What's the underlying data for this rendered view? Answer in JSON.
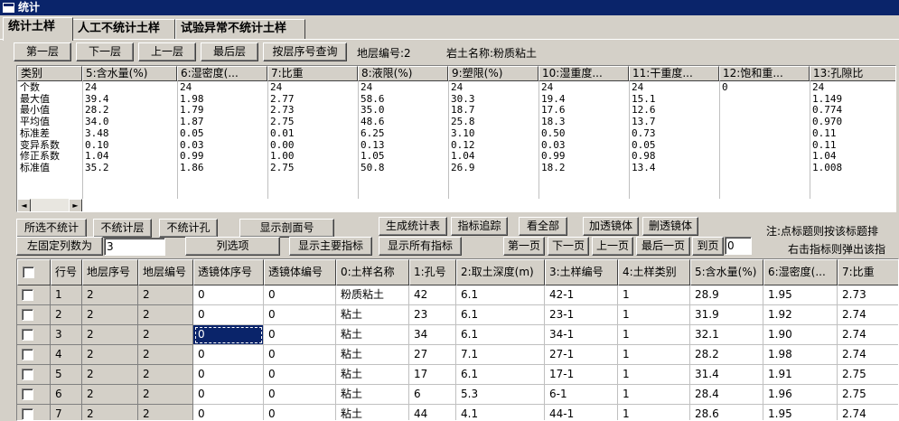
{
  "window": {
    "title": "统计"
  },
  "tabs": [
    "统计土样",
    "人工不统计土样",
    "试验异常不统计土样"
  ],
  "nav_buttons": [
    "第一层",
    "下一层",
    "上一层",
    "最后层",
    "按层序号查询"
  ],
  "layer_info": {
    "layer_label": "地层编号:2",
    "soil_label": "岩土名称:粉质粘土"
  },
  "stats_table": {
    "columns": [
      "类别",
      "5:含水量(%)",
      "6:湿密度(...",
      "7:比重",
      "8:液限(%)",
      "9:塑限(%)",
      "10:湿重度...",
      "11:干重度...",
      "12:饱和重...",
      "13:孔隙比"
    ],
    "rows": [
      [
        "个数",
        "24",
        "24",
        "24",
        "24",
        "24",
        "24",
        "24",
        "0",
        "24"
      ],
      [
        "最大值",
        "39.4",
        "1.98",
        "2.77",
        "58.6",
        "30.3",
        "19.4",
        "15.1",
        "",
        "1.149"
      ],
      [
        "最小值",
        "28.2",
        "1.79",
        "2.73",
        "35.0",
        "18.7",
        "17.6",
        "12.6",
        "",
        "0.774"
      ],
      [
        "平均值",
        "34.0",
        "1.87",
        "2.75",
        "48.6",
        "25.8",
        "18.3",
        "13.7",
        "",
        "0.970"
      ],
      [
        "标准差",
        "3.48",
        "0.05",
        "0.01",
        "6.25",
        "3.10",
        "0.50",
        "0.73",
        "",
        "0.11"
      ],
      [
        "变异系数",
        "0.10",
        "0.03",
        "0.00",
        "0.13",
        "0.12",
        "0.03",
        "0.05",
        "",
        "0.11"
      ],
      [
        "修正系数",
        "1.04",
        "0.99",
        "1.00",
        "1.05",
        "1.04",
        "0.99",
        "0.98",
        "",
        "1.04"
      ],
      [
        "标准值",
        "35.2",
        "1.86",
        "2.75",
        "50.8",
        "26.9",
        "18.2",
        "13.4",
        "",
        "1.008"
      ]
    ]
  },
  "scroll": {
    "left": "◄",
    "right": "►"
  },
  "actions_row1": {
    "select_no_stat": "所选不统计",
    "no_stat_layer": "不统计层",
    "no_stat_hole": "不统计孔",
    "show_section": "显示剖面号",
    "gen_table": "生成统计表",
    "trace": "指标追踪",
    "view_all": "看全部",
    "add_lens": "加透镜体",
    "del_lens": "删透镜体"
  },
  "actions_row2": {
    "fixed_cols_label": "左固定列数为",
    "fixed_cols_value": "3",
    "col_options": "列选项",
    "show_main": "显示主要指标",
    "show_all": "显示所有指标",
    "first_page": "第一页",
    "next_page": "下一页",
    "prev_page": "上一页",
    "last_page": "最后一页",
    "goto_page": "到页",
    "page_value": "0"
  },
  "notes": {
    "line1": "注:点标题则按该标题排",
    "line2": "右击指标则弹出该指"
  },
  "data_grid": {
    "columns": [
      "",
      "行号",
      "地层序号",
      "地层编号",
      "透镜体序号",
      "透镜体编号",
      "0:土样名称",
      "1:孔号",
      "2:取土深度(m)",
      "3:土样编号",
      "4:土样类别",
      "5:含水量(%)",
      "6:湿密度(...",
      "7:比重"
    ],
    "rows": [
      [
        "",
        "1",
        "2",
        "2",
        "0",
        "0",
        "粉质粘土",
        "42",
        "6.1",
        "42-1",
        "1",
        "28.9",
        "1.95",
        "2.73"
      ],
      [
        "",
        "2",
        "2",
        "2",
        "0",
        "0",
        "粘土",
        "23",
        "6.1",
        "23-1",
        "1",
        "31.9",
        "1.92",
        "2.74"
      ],
      [
        "",
        "3",
        "2",
        "2",
        "0",
        "0",
        "粘土",
        "34",
        "6.1",
        "34-1",
        "1",
        "32.1",
        "1.90",
        "2.74"
      ],
      [
        "",
        "4",
        "2",
        "2",
        "0",
        "0",
        "粘土",
        "27",
        "7.1",
        "27-1",
        "1",
        "28.2",
        "1.98",
        "2.74"
      ],
      [
        "",
        "5",
        "2",
        "2",
        "0",
        "0",
        "粘土",
        "17",
        "6.1",
        "17-1",
        "1",
        "31.4",
        "1.91",
        "2.75"
      ],
      [
        "",
        "6",
        "2",
        "2",
        "0",
        "0",
        "粘土",
        "6",
        "5.3",
        "6-1",
        "1",
        "28.4",
        "1.96",
        "2.75"
      ],
      [
        "",
        "7",
        "2",
        "2",
        "0",
        "0",
        "粘土",
        "44",
        "4.1",
        "44-1",
        "1",
        "28.6",
        "1.95",
        "2.74"
      ]
    ]
  }
}
